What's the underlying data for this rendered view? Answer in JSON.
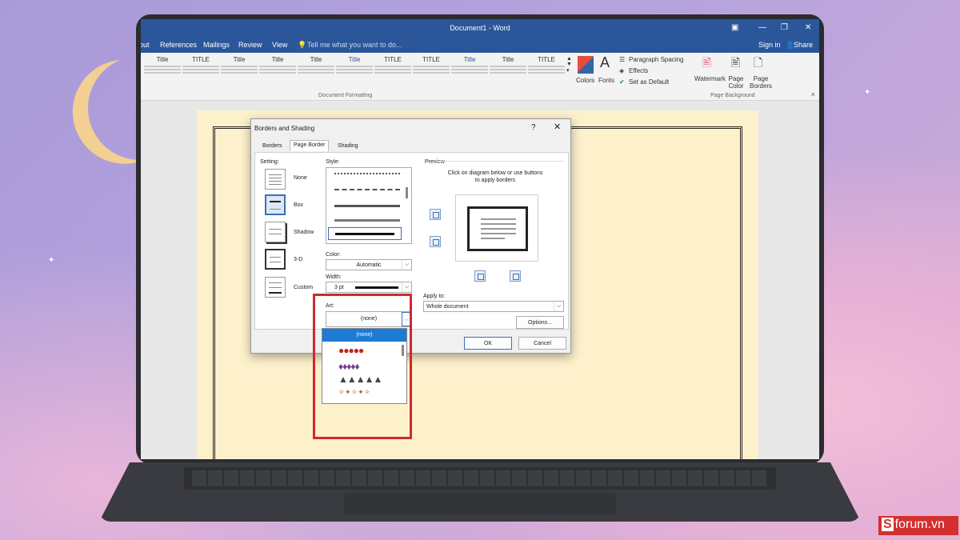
{
  "window": {
    "title": "Document1 - Word",
    "sign_in": "Sign in",
    "share": "Share"
  },
  "menu": {
    "items": [
      "out",
      "References",
      "Mailings",
      "Review",
      "View"
    ],
    "tell_me": "Tell me what you want to do..."
  },
  "ribbon": {
    "styles": [
      "Title",
      "TITLE",
      "Title",
      "Title",
      "Title",
      "Title",
      "TITLE",
      "TITLE",
      "Title",
      "Title",
      "TITLE"
    ],
    "group_document_formatting": "Document Formatting",
    "colors": "Colors",
    "fonts": "Fonts",
    "paragraph_spacing": "Paragraph Spacing",
    "effects": "Effects",
    "set_as_default": "Set as Default",
    "watermark": "Watermark",
    "page_color": "Page Color",
    "page_borders": "Page Borders",
    "group_page_background": "Page Background"
  },
  "dialog": {
    "title": "Borders and Shading",
    "help": "?",
    "close": "✕",
    "tabs": [
      "Borders",
      "Page Border",
      "Shading"
    ],
    "active_tab": "Page Border",
    "setting_label": "Setting:",
    "settings": [
      "None",
      "Box",
      "Shadow",
      "3-D",
      "Custom"
    ],
    "selected_setting": "Box",
    "style_label": "Style:",
    "color_label": "Color:",
    "color_value": "Automatic",
    "width_label": "Width:",
    "width_value": "3 pt",
    "art_label": "Art:",
    "art_value": "(none)",
    "art_option_selected": "(none)",
    "preview_label": "Preview",
    "preview_hint_1": "Click on diagram below or use buttons",
    "preview_hint_2": "to apply borders",
    "apply_to_label": "Apply to:",
    "apply_to_value": "Whole document",
    "options_button": "Options...",
    "ok_button": "OK",
    "cancel_button": "Cancel"
  },
  "watermark_logo": {
    "mark": "S",
    "text": "forum.vn"
  }
}
